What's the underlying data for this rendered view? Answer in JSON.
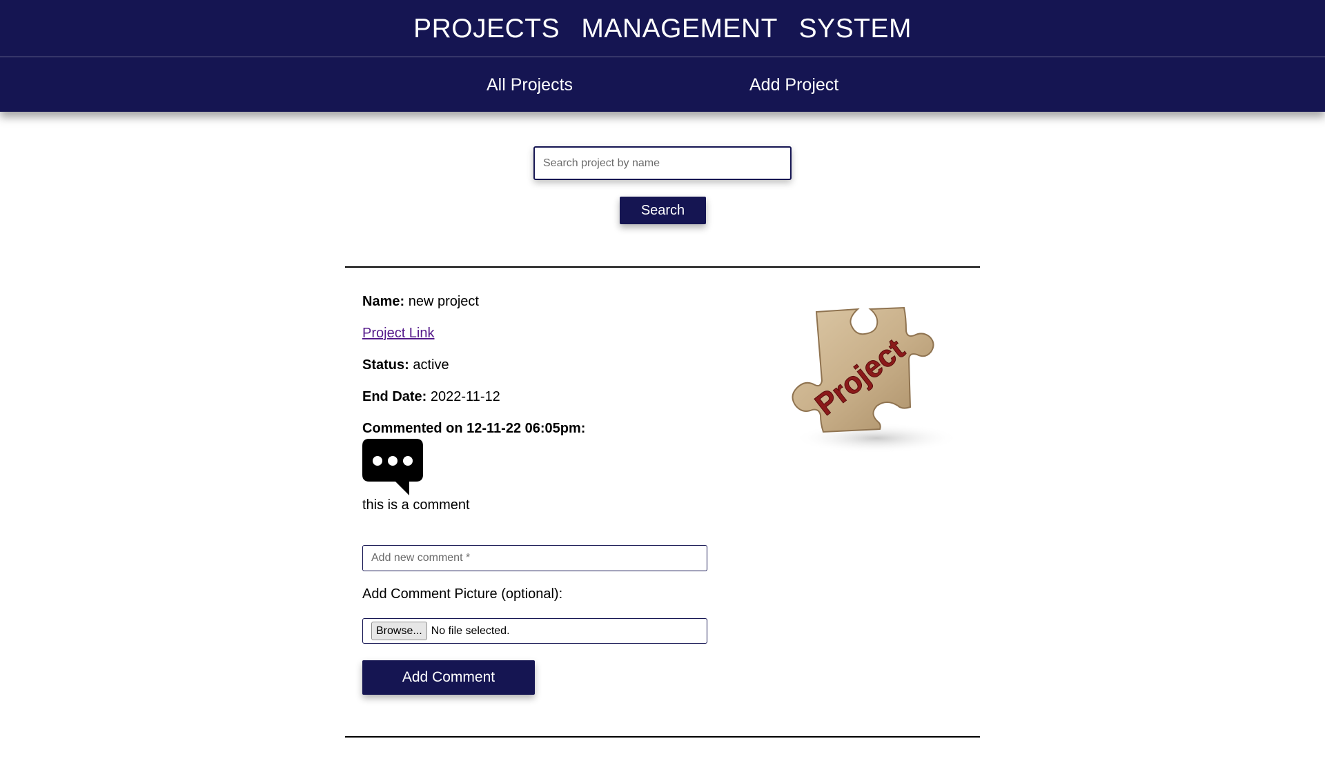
{
  "app": {
    "title": "PROJECTS   MANAGEMENT   SYSTEM"
  },
  "nav": {
    "items": [
      {
        "label": "All Projects"
      },
      {
        "label": "Add Project"
      }
    ]
  },
  "search": {
    "placeholder": "Search project by name",
    "value": "",
    "button_label": "Search"
  },
  "project": {
    "name_label": "Name:",
    "name": "new project",
    "link_text": "Project Link",
    "status_label": "Status:",
    "status": "active",
    "end_date_label": "End Date:",
    "end_date": "2022-11-12",
    "image_text": "Project",
    "comments": [
      {
        "header": "Commented on 12-11-22 06:05pm:",
        "icon": "speech-bubble-icon",
        "text": "this is a comment"
      }
    ]
  },
  "comment_form": {
    "placeholder": "Add new comment *",
    "value": "",
    "picture_label": "Add Comment Picture (optional):",
    "browse_label": "Browse...",
    "file_status": "No file selected.",
    "submit_label": "Add Comment"
  },
  "colors": {
    "primary": "#151552",
    "link_visited": "#551a8b",
    "text": "#000000"
  }
}
